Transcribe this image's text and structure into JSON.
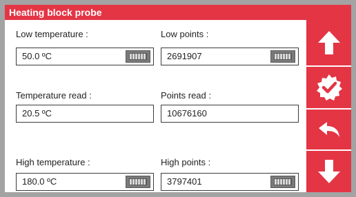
{
  "window": {
    "title": "Heating block probe"
  },
  "fields": {
    "low_temperature": {
      "label": "Low temperature :",
      "value": "50.0 ºC"
    },
    "low_points": {
      "label": "Low points :",
      "value": "2691907"
    },
    "temperature_read": {
      "label": "Temperature read :",
      "value": "20.5 ºC"
    },
    "points_read": {
      "label": "Points read :",
      "value": "10676160"
    },
    "high_temperature": {
      "label": "High temperature :",
      "value": "180.0 ºC"
    },
    "high_points": {
      "label": "High points :",
      "value": "3797401"
    }
  },
  "sidebar": {
    "buttons": [
      {
        "icon": "arrow-up-icon"
      },
      {
        "icon": "check-badge-icon"
      },
      {
        "icon": "back-arrow-icon"
      },
      {
        "icon": "arrow-down-icon"
      }
    ]
  },
  "colors": {
    "accent": "#e43545",
    "background": "#a3a3a3",
    "panel": "#ffffff"
  }
}
